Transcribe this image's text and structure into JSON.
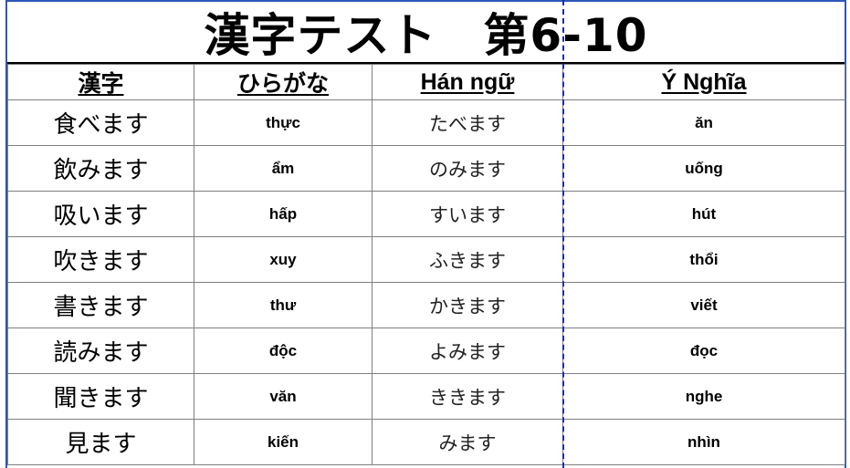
{
  "title": "漢字テスト　第6-10",
  "headers": [
    "漢字",
    "ひらがな",
    "Hán ngữ",
    "Ý Nghĩa"
  ],
  "rows": [
    {
      "kanji": "食べます",
      "hanviet": "thực",
      "hiragana": "たべます",
      "meaning": "ăn"
    },
    {
      "kanji": "飲みます",
      "hanviet": "ẩm",
      "hiragana": "のみます",
      "meaning": "uống"
    },
    {
      "kanji": "吸います",
      "hanviet": "hấp",
      "hiragana": "すいます",
      "meaning": "hút"
    },
    {
      "kanji": "吹きます",
      "hanviet": "xuy",
      "hiragana": "ふきます",
      "meaning": "thổi"
    },
    {
      "kanji": "書きます",
      "hanviet": "thư",
      "hiragana": "かきます",
      "meaning": "viết"
    },
    {
      "kanji": "読みます",
      "hanviet": "độc",
      "hiragana": "よみます",
      "meaning": "đọc"
    },
    {
      "kanji": "聞きます",
      "hanviet": "văn",
      "hiragana": "ききます",
      "meaning": "nghe"
    },
    {
      "kanji": "見ます",
      "hanviet": "kiến",
      "hiragana": "みます",
      "meaning": "nhìn"
    }
  ],
  "colors": {
    "sheet_border": "#2d56b8",
    "page_break": "#1a2ea8",
    "grid": "#7f7f7f"
  }
}
